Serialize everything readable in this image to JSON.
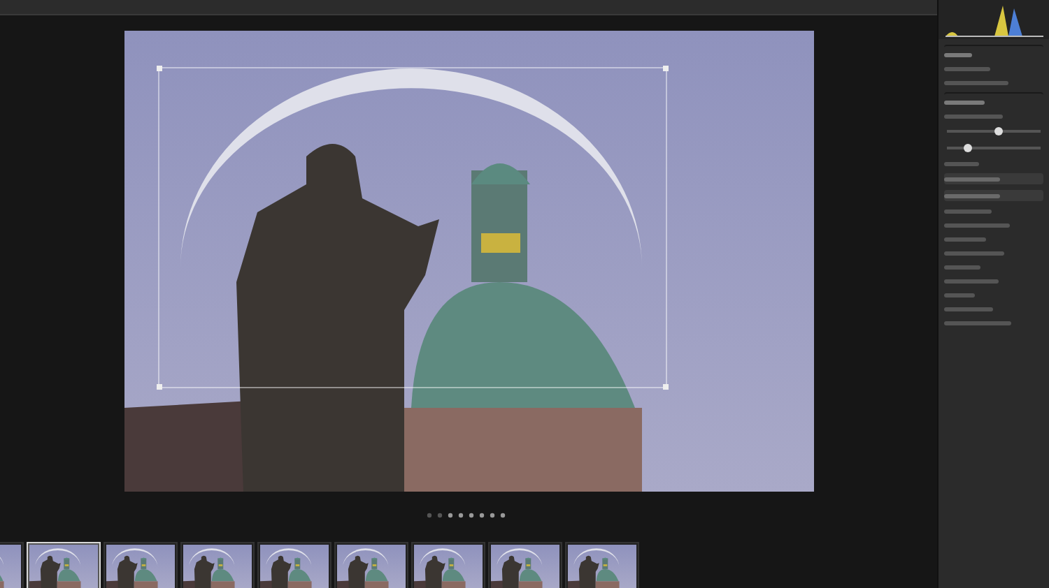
{
  "crop": {
    "visible": true
  },
  "adjustments": [
    {
      "level": 0.55
    },
    {
      "level": 0.22
    }
  ],
  "panel_rows": [
    {
      "kind": "header"
    },
    {
      "kind": "line"
    },
    {
      "kind": "line"
    },
    {
      "kind": "header"
    },
    {
      "kind": "line"
    },
    {
      "kind": "line"
    },
    {
      "kind": "button"
    },
    {
      "kind": "button"
    },
    {
      "kind": "line"
    },
    {
      "kind": "line"
    },
    {
      "kind": "line"
    },
    {
      "kind": "line"
    },
    {
      "kind": "line"
    },
    {
      "kind": "line"
    },
    {
      "kind": "line"
    },
    {
      "kind": "line"
    },
    {
      "kind": "line"
    }
  ],
  "filmstrip": {
    "thumbnails": [
      {
        "selected": false
      },
      {
        "selected": true
      },
      {
        "selected": false
      },
      {
        "selected": false
      },
      {
        "selected": false
      },
      {
        "selected": false
      },
      {
        "selected": false
      },
      {
        "selected": false
      },
      {
        "selected": false
      }
    ]
  }
}
